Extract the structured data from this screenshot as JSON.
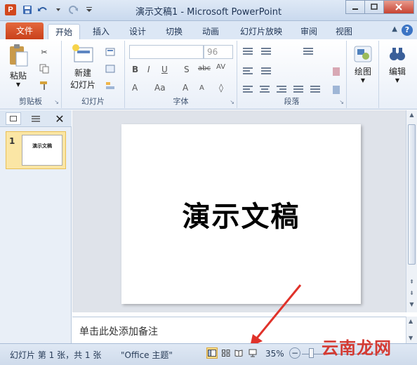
{
  "titlebar": {
    "app_icon_letter": "P",
    "title": "演示文稿1 - Microsoft PowerPoint",
    "qat": [
      "save-icon",
      "undo-icon",
      "redo-icon",
      "customize-icon"
    ],
    "win_controls": [
      "minimize",
      "maximize",
      "close"
    ]
  },
  "tabs": {
    "file": "文件",
    "items": [
      "开始",
      "插入",
      "设计",
      "切换",
      "动画",
      "幻灯片放映",
      "审阅",
      "视图"
    ],
    "help": "?"
  },
  "ribbon": {
    "clipboard": {
      "label": "剪贴板",
      "paste": "粘贴"
    },
    "slides": {
      "label": "幻灯片",
      "new_slide_line1": "新建",
      "new_slide_line2": "幻灯片"
    },
    "font": {
      "label": "字体",
      "size": "96"
    },
    "paragraph": {
      "label": "段落"
    },
    "drawing": {
      "label": "绘图"
    },
    "editing": {
      "label": "编辑"
    }
  },
  "panel": {
    "slide_number": "1",
    "thumbnail_text": "演示文稿"
  },
  "slide": {
    "title": "演示文稿"
  },
  "notes": {
    "placeholder": "单击此处添加备注"
  },
  "status": {
    "slide_info": "幻灯片 第 1 张，共 1 张",
    "theme": "\"Office 主题\"",
    "zoom": "35%"
  },
  "watermark": "云南龙网",
  "colors": {
    "file_tab": "#c9411b",
    "accent_blue": "#3b74c4",
    "annotation_arrow": "#e0322a"
  }
}
